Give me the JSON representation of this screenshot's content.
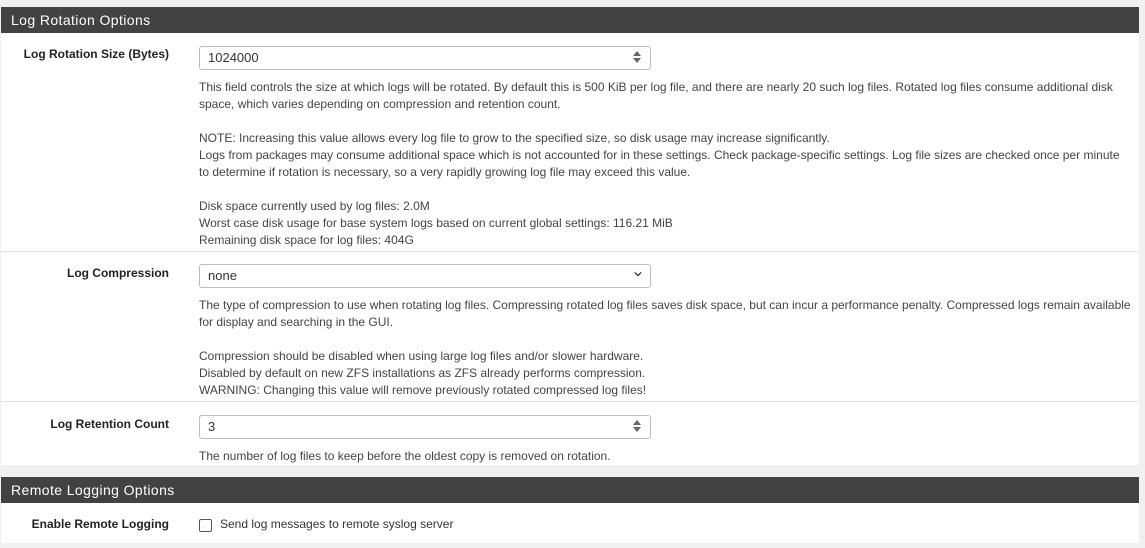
{
  "log_rotation": {
    "heading": "Log Rotation Options",
    "size": {
      "label": "Log Rotation Size (Bytes)",
      "value": "1024000",
      "help": [
        "This field controls the size at which logs will be rotated. By default this is 500 KiB per log file, and there are nearly 20 such log files. Rotated log files consume additional disk space, which varies depending on compression and retention count.",
        "NOTE: Increasing this value allows every log file to grow to the specified size, so disk usage may increase significantly.",
        "Logs from packages may consume additional space which is not accounted for in these settings. Check package-specific settings. Log file sizes are checked once per minute to determine if rotation is necessary, so a very rapidly growing log file may exceed this value.",
        "Disk space currently used by log files: 2.0M",
        "Worst case disk usage for base system logs based on current global settings: 116.21 MiB",
        "Remaining disk space for log files: 404G"
      ]
    },
    "compression": {
      "label": "Log Compression",
      "value": "none",
      "help": [
        "The type of compression to use when rotating log files. Compressing rotated log files saves disk space, but can incur a performance penalty. Compressed logs remain available for display and searching in the GUI.",
        "Compression should be disabled when using large log files and/or slower hardware.",
        "Disabled by default on new ZFS installations as ZFS already performs compression.",
        "WARNING: Changing this value will remove previously rotated compressed log files!"
      ]
    },
    "retention": {
      "label": "Log Retention Count",
      "value": "3",
      "help": "The number of log files to keep before the oldest copy is removed on rotation."
    }
  },
  "remote_logging": {
    "heading": "Remote Logging Options",
    "enable": {
      "label": "Enable Remote Logging",
      "checkbox_label": "Send log messages to remote syslog server",
      "checked": false
    }
  }
}
